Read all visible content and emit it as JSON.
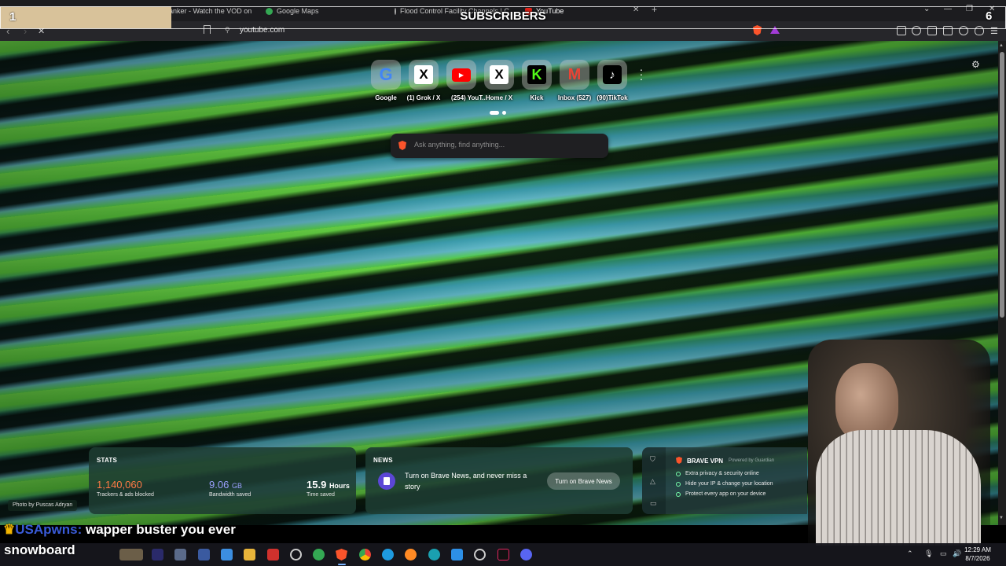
{
  "browser": {
    "tabs": [
      {
        "label": "anker - Watch the VOD on K"
      },
      {
        "label": "Google Maps"
      },
      {
        "label": "Flood Control Facility Channels | Cl"
      },
      {
        "label": "YouTube"
      }
    ],
    "address": "youtube.com"
  },
  "overlay": {
    "left_count": "1",
    "title": "SUBSCRIBERS",
    "right_count": "6"
  },
  "topsites": [
    {
      "label": "Google",
      "icon": "google-icon"
    },
    {
      "label": "(1) Grok / X",
      "icon": "x-icon"
    },
    {
      "label": "(254) YouT...",
      "icon": "youtube-icon"
    },
    {
      "label": "Home / X",
      "icon": "x-icon"
    },
    {
      "label": "Kick",
      "icon": "kick-icon"
    },
    {
      "label": "Inbox (527)",
      "icon": "gmail-icon"
    },
    {
      "label": "(90)TikTok",
      "icon": "tiktok-icon"
    }
  ],
  "search": {
    "placeholder": "Ask anything, find anything..."
  },
  "stats": {
    "title": "STATS",
    "trackers": {
      "value": "1,140,060",
      "label": "Trackers & ads blocked",
      "color": "#ff7a45"
    },
    "bandwidth": {
      "value": "9.06",
      "unit": "GB",
      "label": "Bandwidth saved",
      "color": "#9aa0ff"
    },
    "time": {
      "value": "15.9",
      "unit": "Hours",
      "label": "Time saved"
    }
  },
  "news": {
    "title": "NEWS",
    "text": "Turn on Brave News, and never miss a story",
    "button": "Turn on Brave News"
  },
  "vpn": {
    "title": "BRAVE VPN",
    "powered": "Powered by",
    "partner": "Guardian",
    "items": [
      "Extra privacy & security online",
      "Hide your IP & change your location",
      "Protect every app on your device"
    ]
  },
  "photo_credit": "Photo by Puscas Adryan",
  "chat": {
    "user": "USApwns:",
    "message": "wapper buster you ever"
  },
  "stream_label": "snowboard",
  "clock": {
    "time": "12:29 AM",
    "date": "8/7/2026"
  },
  "colors": {
    "brave_orange": "#fb542b",
    "accent": "#7ab3ff"
  }
}
